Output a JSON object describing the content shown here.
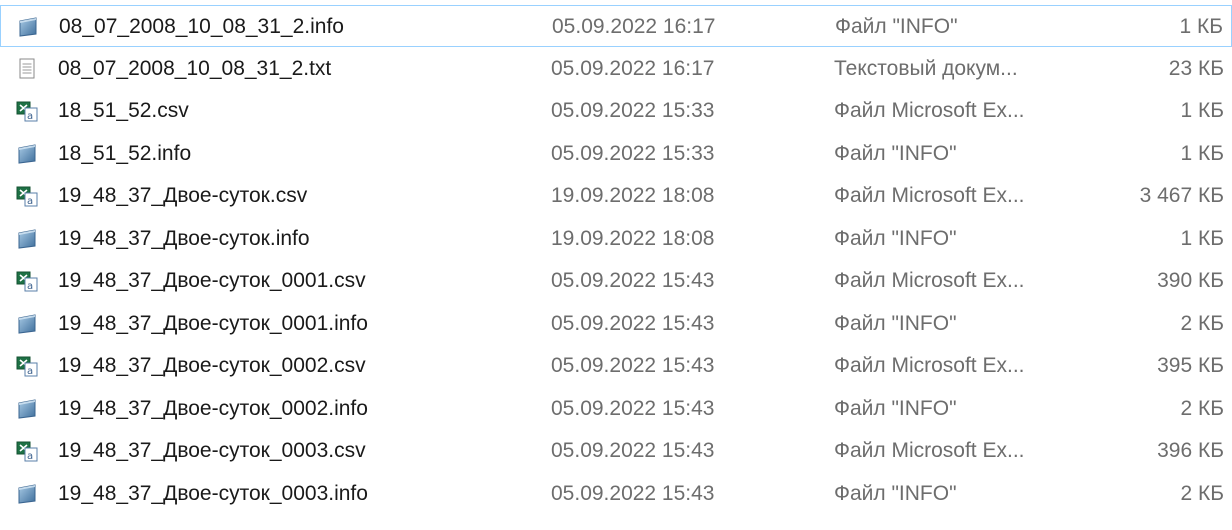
{
  "files": [
    {
      "name": "08_07_2008_10_08_31_2.info",
      "modified": "05.09.2022 16:17",
      "type": "Файл \"INFO\"",
      "size": "1 КБ",
      "icon": "info-file-icon",
      "selected": true
    },
    {
      "name": "08_07_2008_10_08_31_2.txt",
      "modified": "05.09.2022 16:17",
      "type": "Текстовый докум...",
      "size": "23 КБ",
      "icon": "text-file-icon"
    },
    {
      "name": "18_51_52.csv",
      "modified": "05.09.2022 15:33",
      "type": "Файл Microsoft Ex...",
      "size": "1 КБ",
      "icon": "csv-excel-icon"
    },
    {
      "name": "18_51_52.info",
      "modified": "05.09.2022 15:33",
      "type": "Файл \"INFO\"",
      "size": "1 КБ",
      "icon": "info-file-icon"
    },
    {
      "name": "19_48_37_Двое-суток.csv",
      "modified": "19.09.2022 18:08",
      "type": "Файл Microsoft Ex...",
      "size": "3 467 КБ",
      "icon": "csv-excel-icon"
    },
    {
      "name": "19_48_37_Двое-суток.info",
      "modified": "19.09.2022 18:08",
      "type": "Файл \"INFO\"",
      "size": "1 КБ",
      "icon": "info-file-icon"
    },
    {
      "name": "19_48_37_Двое-суток_0001.csv",
      "modified": "05.09.2022 15:43",
      "type": "Файл Microsoft Ex...",
      "size": "390 КБ",
      "icon": "csv-excel-icon"
    },
    {
      "name": "19_48_37_Двое-суток_0001.info",
      "modified": "05.09.2022 15:43",
      "type": "Файл \"INFO\"",
      "size": "2 КБ",
      "icon": "info-file-icon"
    },
    {
      "name": "19_48_37_Двое-суток_0002.csv",
      "modified": "05.09.2022 15:43",
      "type": "Файл Microsoft Ex...",
      "size": "395 КБ",
      "icon": "csv-excel-icon"
    },
    {
      "name": "19_48_37_Двое-суток_0002.info",
      "modified": "05.09.2022 15:43",
      "type": "Файл \"INFO\"",
      "size": "2 КБ",
      "icon": "info-file-icon"
    },
    {
      "name": "19_48_37_Двое-суток_0003.csv",
      "modified": "05.09.2022 15:43",
      "type": "Файл Microsoft Ex...",
      "size": "396 КБ",
      "icon": "csv-excel-icon"
    },
    {
      "name": "19_48_37_Двое-суток_0003.info",
      "modified": "05.09.2022 15:43",
      "type": "Файл \"INFO\"",
      "size": "2 КБ",
      "icon": "info-file-icon"
    }
  ],
  "colors": {
    "selection_border": "#99d1ff",
    "secondary_text": "#6d6d6d",
    "excel_green": "#1e7145"
  }
}
